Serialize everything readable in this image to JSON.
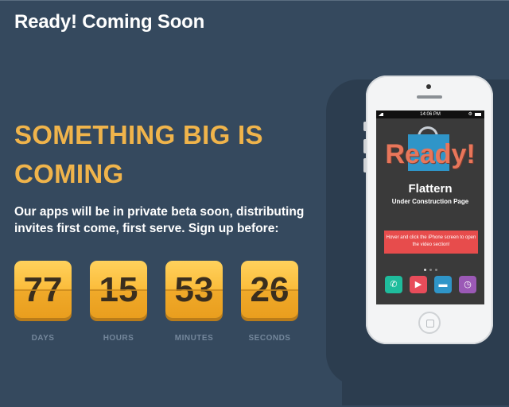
{
  "header": {
    "title": "Ready! Coming Soon"
  },
  "hero": {
    "headline": "SOMETHING BIG IS COMING",
    "description": "Our apps will be in private beta soon, distributing invites first come, first serve. Sign up before:"
  },
  "countdown": [
    {
      "value": "77",
      "label": "DAYS"
    },
    {
      "value": "15",
      "label": "HOURS"
    },
    {
      "value": "53",
      "label": "MINUTES"
    },
    {
      "value": "26",
      "label": "SECONDS"
    }
  ],
  "phone": {
    "status_time": "14:06 PM",
    "logo": "Ready!",
    "app_title": "Flattern",
    "app_subtitle": "Under Construction Page",
    "cta": "Hover and click the iPhone screen to open the video section!",
    "page_dots": 3,
    "active_dot": 1,
    "icons": [
      {
        "name": "phone-icon",
        "glyph": "✆",
        "color": "#1fbc9c"
      },
      {
        "name": "play-icon",
        "glyph": "▶",
        "color": "#e84c5a"
      },
      {
        "name": "chat-icon",
        "glyph": "▬",
        "color": "#2f95c8"
      },
      {
        "name": "clock-icon",
        "glyph": "◷",
        "color": "#9b59b6"
      }
    ]
  },
  "colors": {
    "background": "#35495e",
    "accent": "#f0b44b",
    "counter": "#fbbd3c"
  }
}
